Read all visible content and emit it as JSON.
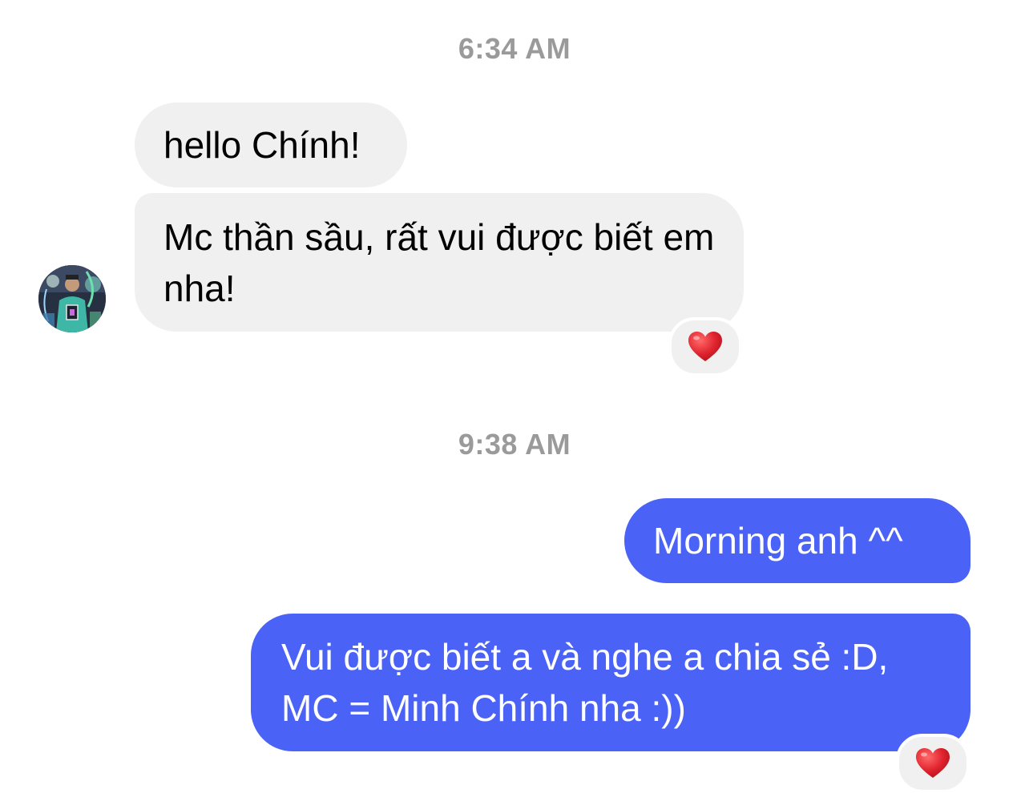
{
  "conversation": {
    "groups": [
      {
        "timestamp": "6:34 AM",
        "messages": [
          {
            "text": "hello Chính!",
            "sender": "them"
          },
          {
            "text": "Mc thần sầu, rất vui được biết em nha!",
            "sender": "them",
            "reaction": "heart"
          }
        ]
      },
      {
        "timestamp": "9:38 AM",
        "messages": [
          {
            "text": "Morning anh ^^",
            "sender": "me"
          },
          {
            "text": "Vui được biết a và nghe a chia sẻ :D, MC = Minh Chính nha :))",
            "sender": "me",
            "reaction": "heart"
          }
        ]
      }
    ]
  },
  "colors": {
    "outgoing_bubble": "#4a62f6",
    "incoming_bubble": "#f0f0f0",
    "timestamp_text": "#9a9a9a",
    "heart": "#e0242f"
  },
  "icons": {
    "avatar": "contact-avatar",
    "reaction": "heart-icon"
  }
}
